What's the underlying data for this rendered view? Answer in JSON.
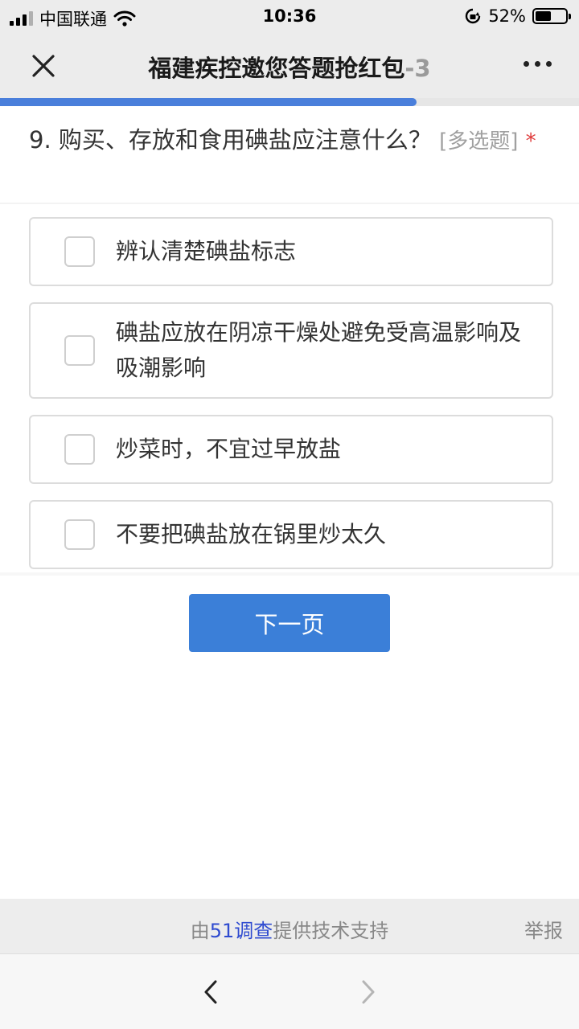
{
  "status_bar": {
    "carrier": "中国联通",
    "time": "10:36",
    "battery_percent": "52%",
    "battery_level": 0.52
  },
  "nav": {
    "title": "福建疾控邀您答题抢红包",
    "title_fade": "-3"
  },
  "progress": {
    "fraction": 0.72
  },
  "question": {
    "text": "9. 购买、存放和食用碘盐应注意什么？",
    "tag": "[多选题]",
    "required_mark": "*"
  },
  "options": [
    {
      "label": "辨认清楚碘盐标志",
      "checked": false
    },
    {
      "label": "碘盐应放在阴凉干燥处避免受高温影响及吸潮影响",
      "checked": false
    },
    {
      "label": "炒菜时，不宜过早放盐",
      "checked": false
    },
    {
      "label": "不要把碘盐放在锅里炒太久",
      "checked": false
    }
  ],
  "next_button": {
    "label": "下一页"
  },
  "footer": {
    "prefix": "由",
    "brand": "51调查",
    "suffix": "提供技术支持",
    "report": "举报"
  },
  "colors": {
    "accent": "#3b7fd8",
    "progress": "#4a7fdb",
    "required": "#e03b3b",
    "brand_link": "#2f4bd0"
  }
}
